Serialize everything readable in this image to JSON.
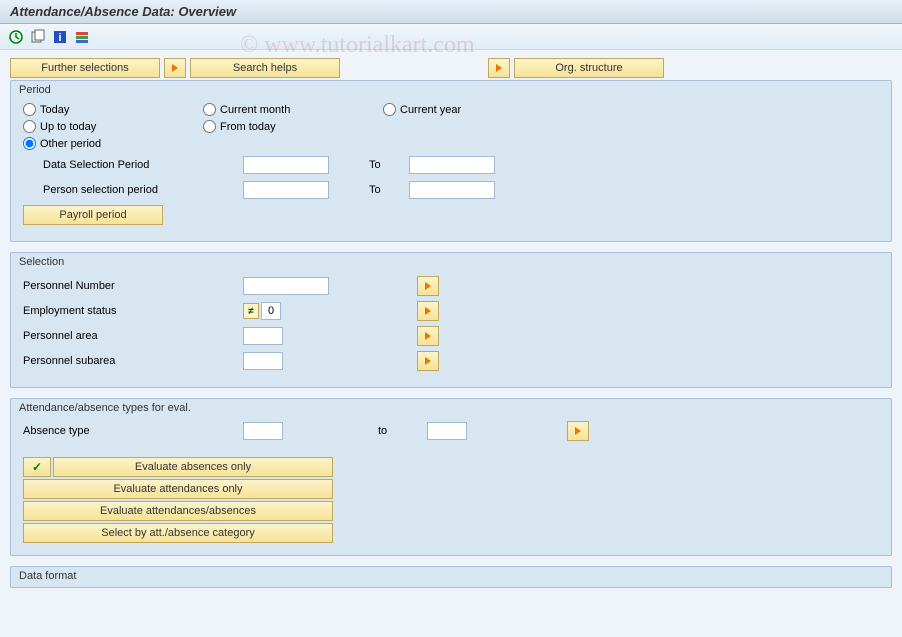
{
  "title": "Attendance/Absence Data: Overview",
  "watermark": "© www.tutorialkart.com",
  "buttons": {
    "further_selections": "Further selections",
    "search_helps": "Search helps",
    "org_structure": "Org. structure",
    "payroll_period": "Payroll period"
  },
  "period": {
    "title": "Period",
    "today": "Today",
    "current_month": "Current month",
    "current_year": "Current year",
    "up_to_today": "Up to today",
    "from_today": "From today",
    "other_period": "Other period",
    "data_selection": "Data Selection Period",
    "person_selection": "Person selection period",
    "to": "To",
    "data_from": "",
    "data_to": "",
    "person_from": "",
    "person_to": ""
  },
  "selection": {
    "title": "Selection",
    "personnel_number": "Personnel Number",
    "employment_status": "Employment status",
    "personnel_area": "Personnel area",
    "personnel_subarea": "Personnel subarea",
    "pn_val": "",
    "es_val": "0",
    "pa_val": "",
    "psa_val": ""
  },
  "attn": {
    "title": "Attendance/absence types for eval.",
    "absence_type": "Absence type",
    "to": "to",
    "at_from": "",
    "at_to": "",
    "eval_absences": "Evaluate absences only",
    "eval_attendances": "Evaluate attendances only",
    "eval_both": "Evaluate attendances/absences",
    "select_category": "Select by att./absence category"
  },
  "data_format": {
    "title": "Data format"
  }
}
